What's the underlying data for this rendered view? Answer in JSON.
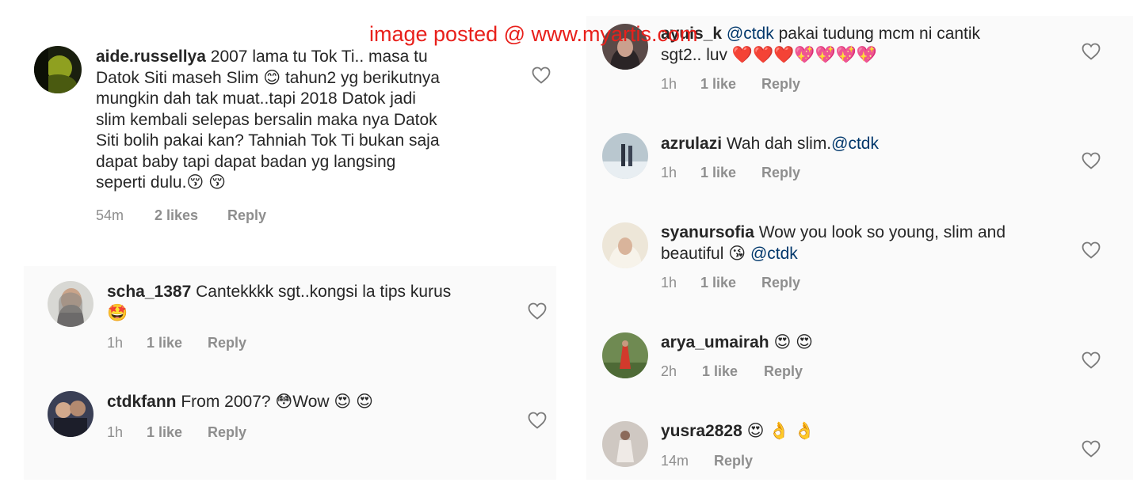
{
  "watermark": "image posted @ www.myartis.com",
  "icons": {
    "like": "heart-outline-icon"
  },
  "colors": {
    "mention": "#00376b",
    "meta": "#8e8e8e",
    "watermark": "#e8201b"
  },
  "comments": [
    {
      "username": "aide.russellya",
      "lines": [
        "2007 lama tu Tok Ti.. masa tu",
        "Datok Siti maseh Slim 😊 tahun2 yg berikutnya",
        "mungkin dah tak muat..tapi 2018 Datok jadi",
        "slim kembali selepas bersalin maka nya Datok",
        "Siti bolih pakai kan? Tahniah Tok Ti bukan saja",
        "dapat baby tapi dapat badan yg langsing",
        "seperti dulu.😚 😚"
      ],
      "time": "54m",
      "likes": "2 likes",
      "reply": "Reply"
    },
    {
      "username": "scha_1387",
      "lines": [
        "Cantekkkk sgt..kongsi la tips kurus",
        "🤩"
      ],
      "time": "1h",
      "likes": "1 like",
      "reply": "Reply"
    },
    {
      "username": "ctdkfann",
      "lines": [
        "From 2007? 😳Wow 😍 😍"
      ],
      "time": "1h",
      "likes": "1 like",
      "reply": "Reply"
    },
    {
      "username": "ayuis_k",
      "mention": "@ctdk",
      "lines": [
        "pakai tudung mcm ni cantik",
        "sgt2.. luv ❤️❤️❤️💖💖💖💖"
      ],
      "time": "1h",
      "likes": "1 like",
      "reply": "Reply"
    },
    {
      "username": "azrulazi",
      "text": "Wah dah slim.",
      "mention": "@ctdk",
      "time": "1h",
      "likes": "1 like",
      "reply": "Reply"
    },
    {
      "username": "syanursofia",
      "lines": [
        "Wow you look so young, slim and",
        "beautiful 😘"
      ],
      "mention": "@ctdk",
      "time": "1h",
      "likes": "1 like",
      "reply": "Reply"
    },
    {
      "username": "arya_umairah",
      "lines": [
        "😍 😍"
      ],
      "time": "2h",
      "likes": "1 like",
      "reply": "Reply"
    },
    {
      "username": "yusra2828",
      "lines": [
        "😍 👌 👌"
      ],
      "time": "14m",
      "reply": "Reply"
    }
  ]
}
